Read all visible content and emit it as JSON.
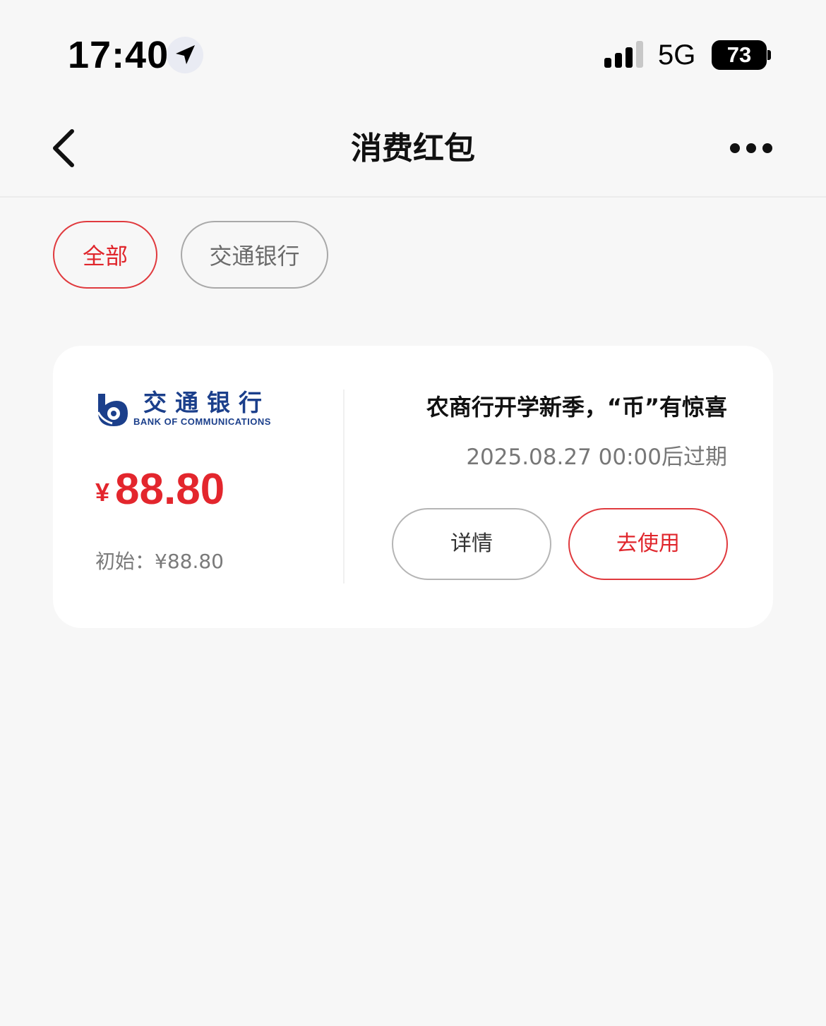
{
  "status_bar": {
    "time": "17:40",
    "network": "5G",
    "battery": "73",
    "icons": [
      "location-arrow-icon",
      "signal-bars-icon",
      "battery-icon"
    ]
  },
  "nav": {
    "title": "消费红包",
    "back_icon": "chevron-left-icon",
    "more_icon": "more-dots-icon"
  },
  "filters": {
    "all": "全部",
    "bank": "交通银行",
    "selected": "全部"
  },
  "coupon": {
    "bank_name_cn": "交通银行",
    "bank_name_en": "BANK OF COMMUNICATIONS",
    "currency": "¥",
    "amount": "88.80",
    "initial": "初始：¥88.80",
    "title": "农商行开学新季，“币”有惊喜",
    "expiry": "2025.08.27 00:00后过期",
    "detail_label": "详情",
    "use_label": "去使用"
  },
  "colors": {
    "accent": "#e0262c",
    "background": "#f7f7f7",
    "bank_blue": "#1b3f8b"
  }
}
